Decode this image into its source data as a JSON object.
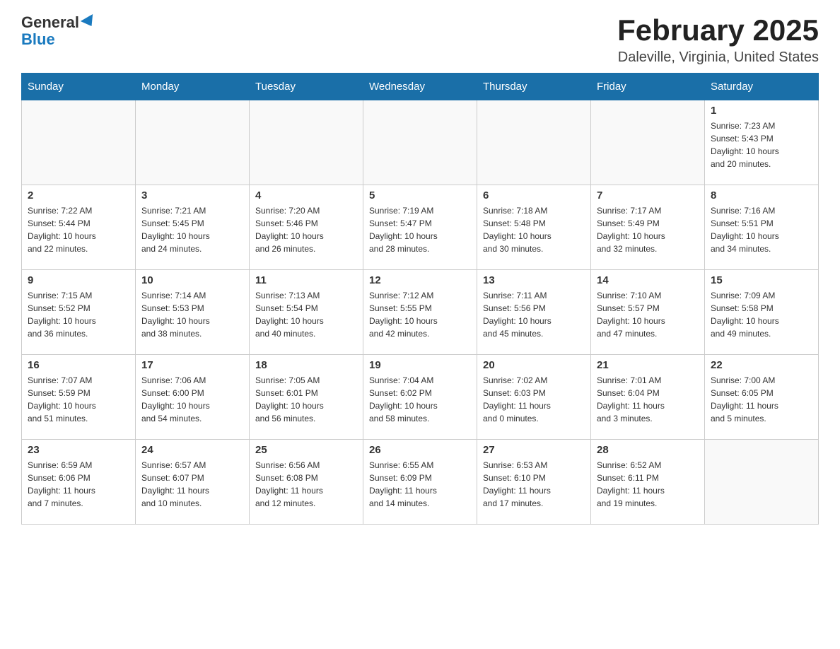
{
  "logo": {
    "general": "General",
    "blue": "Blue"
  },
  "title": "February 2025",
  "subtitle": "Daleville, Virginia, United States",
  "days_of_week": [
    "Sunday",
    "Monday",
    "Tuesday",
    "Wednesday",
    "Thursday",
    "Friday",
    "Saturday"
  ],
  "weeks": [
    [
      {
        "day": "",
        "info": ""
      },
      {
        "day": "",
        "info": ""
      },
      {
        "day": "",
        "info": ""
      },
      {
        "day": "",
        "info": ""
      },
      {
        "day": "",
        "info": ""
      },
      {
        "day": "",
        "info": ""
      },
      {
        "day": "1",
        "info": "Sunrise: 7:23 AM\nSunset: 5:43 PM\nDaylight: 10 hours\nand 20 minutes."
      }
    ],
    [
      {
        "day": "2",
        "info": "Sunrise: 7:22 AM\nSunset: 5:44 PM\nDaylight: 10 hours\nand 22 minutes."
      },
      {
        "day": "3",
        "info": "Sunrise: 7:21 AM\nSunset: 5:45 PM\nDaylight: 10 hours\nand 24 minutes."
      },
      {
        "day": "4",
        "info": "Sunrise: 7:20 AM\nSunset: 5:46 PM\nDaylight: 10 hours\nand 26 minutes."
      },
      {
        "day": "5",
        "info": "Sunrise: 7:19 AM\nSunset: 5:47 PM\nDaylight: 10 hours\nand 28 minutes."
      },
      {
        "day": "6",
        "info": "Sunrise: 7:18 AM\nSunset: 5:48 PM\nDaylight: 10 hours\nand 30 minutes."
      },
      {
        "day": "7",
        "info": "Sunrise: 7:17 AM\nSunset: 5:49 PM\nDaylight: 10 hours\nand 32 minutes."
      },
      {
        "day": "8",
        "info": "Sunrise: 7:16 AM\nSunset: 5:51 PM\nDaylight: 10 hours\nand 34 minutes."
      }
    ],
    [
      {
        "day": "9",
        "info": "Sunrise: 7:15 AM\nSunset: 5:52 PM\nDaylight: 10 hours\nand 36 minutes."
      },
      {
        "day": "10",
        "info": "Sunrise: 7:14 AM\nSunset: 5:53 PM\nDaylight: 10 hours\nand 38 minutes."
      },
      {
        "day": "11",
        "info": "Sunrise: 7:13 AM\nSunset: 5:54 PM\nDaylight: 10 hours\nand 40 minutes."
      },
      {
        "day": "12",
        "info": "Sunrise: 7:12 AM\nSunset: 5:55 PM\nDaylight: 10 hours\nand 42 minutes."
      },
      {
        "day": "13",
        "info": "Sunrise: 7:11 AM\nSunset: 5:56 PM\nDaylight: 10 hours\nand 45 minutes."
      },
      {
        "day": "14",
        "info": "Sunrise: 7:10 AM\nSunset: 5:57 PM\nDaylight: 10 hours\nand 47 minutes."
      },
      {
        "day": "15",
        "info": "Sunrise: 7:09 AM\nSunset: 5:58 PM\nDaylight: 10 hours\nand 49 minutes."
      }
    ],
    [
      {
        "day": "16",
        "info": "Sunrise: 7:07 AM\nSunset: 5:59 PM\nDaylight: 10 hours\nand 51 minutes."
      },
      {
        "day": "17",
        "info": "Sunrise: 7:06 AM\nSunset: 6:00 PM\nDaylight: 10 hours\nand 54 minutes."
      },
      {
        "day": "18",
        "info": "Sunrise: 7:05 AM\nSunset: 6:01 PM\nDaylight: 10 hours\nand 56 minutes."
      },
      {
        "day": "19",
        "info": "Sunrise: 7:04 AM\nSunset: 6:02 PM\nDaylight: 10 hours\nand 58 minutes."
      },
      {
        "day": "20",
        "info": "Sunrise: 7:02 AM\nSunset: 6:03 PM\nDaylight: 11 hours\nand 0 minutes."
      },
      {
        "day": "21",
        "info": "Sunrise: 7:01 AM\nSunset: 6:04 PM\nDaylight: 11 hours\nand 3 minutes."
      },
      {
        "day": "22",
        "info": "Sunrise: 7:00 AM\nSunset: 6:05 PM\nDaylight: 11 hours\nand 5 minutes."
      }
    ],
    [
      {
        "day": "23",
        "info": "Sunrise: 6:59 AM\nSunset: 6:06 PM\nDaylight: 11 hours\nand 7 minutes."
      },
      {
        "day": "24",
        "info": "Sunrise: 6:57 AM\nSunset: 6:07 PM\nDaylight: 11 hours\nand 10 minutes."
      },
      {
        "day": "25",
        "info": "Sunrise: 6:56 AM\nSunset: 6:08 PM\nDaylight: 11 hours\nand 12 minutes."
      },
      {
        "day": "26",
        "info": "Sunrise: 6:55 AM\nSunset: 6:09 PM\nDaylight: 11 hours\nand 14 minutes."
      },
      {
        "day": "27",
        "info": "Sunrise: 6:53 AM\nSunset: 6:10 PM\nDaylight: 11 hours\nand 17 minutes."
      },
      {
        "day": "28",
        "info": "Sunrise: 6:52 AM\nSunset: 6:11 PM\nDaylight: 11 hours\nand 19 minutes."
      },
      {
        "day": "",
        "info": ""
      }
    ]
  ]
}
